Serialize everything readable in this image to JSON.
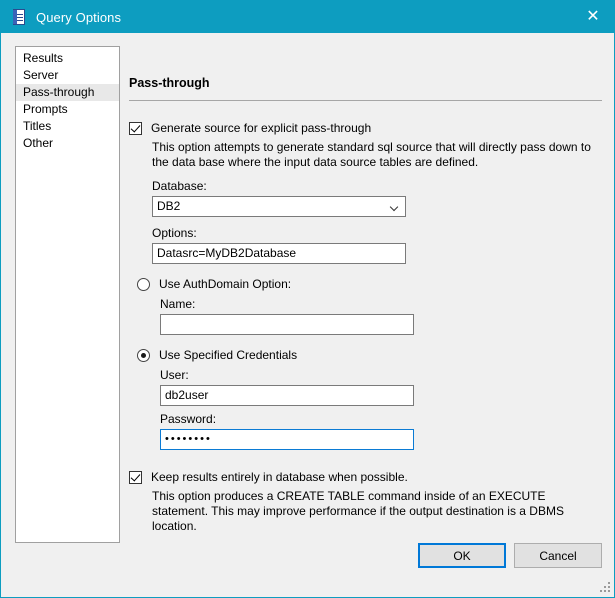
{
  "window": {
    "title": "Query Options",
    "icon": "document-properties-icon",
    "close_label": "✕",
    "accent_color": "#0d9dc0",
    "background_color": "#f0f0f0"
  },
  "sidebar": {
    "items": [
      {
        "label": "Results",
        "selected": false
      },
      {
        "label": "Server",
        "selected": false
      },
      {
        "label": "Pass-through",
        "selected": true
      },
      {
        "label": "Prompts",
        "selected": false
      },
      {
        "label": "Titles",
        "selected": false
      },
      {
        "label": "Other",
        "selected": false
      }
    ]
  },
  "pane": {
    "heading": "Pass-through",
    "generate_source": {
      "label": "Generate source for explicit pass-through",
      "checked": true,
      "description": "This option attempts to generate standard sql source that will directly pass down to the data base where the input data source tables are defined."
    },
    "database": {
      "label": "Database:",
      "value": "DB2",
      "options": [
        "DB2"
      ]
    },
    "options_field": {
      "label": "Options:",
      "value": "Datasrc=MyDB2Database",
      "placeholder": ""
    },
    "auth_domain": {
      "label": "Use AuthDomain Option:",
      "selected": false,
      "name_label": "Name:",
      "name_value": "",
      "name_placeholder": ""
    },
    "specified_credentials": {
      "label": "Use Specified Credentials",
      "selected": true,
      "user_label": "User:",
      "user_value": "db2user",
      "password_label": "Password:",
      "password_value": "••••••••",
      "password_focused": true
    },
    "keep_results": {
      "label": "Keep results entirely in database when possible.",
      "checked": true,
      "description": "This option produces a CREATE TABLE command inside of an EXECUTE statement.  This may improve performance if the output destination is a DBMS location."
    }
  },
  "footer": {
    "ok_label": "OK",
    "cancel_label": "Cancel"
  }
}
